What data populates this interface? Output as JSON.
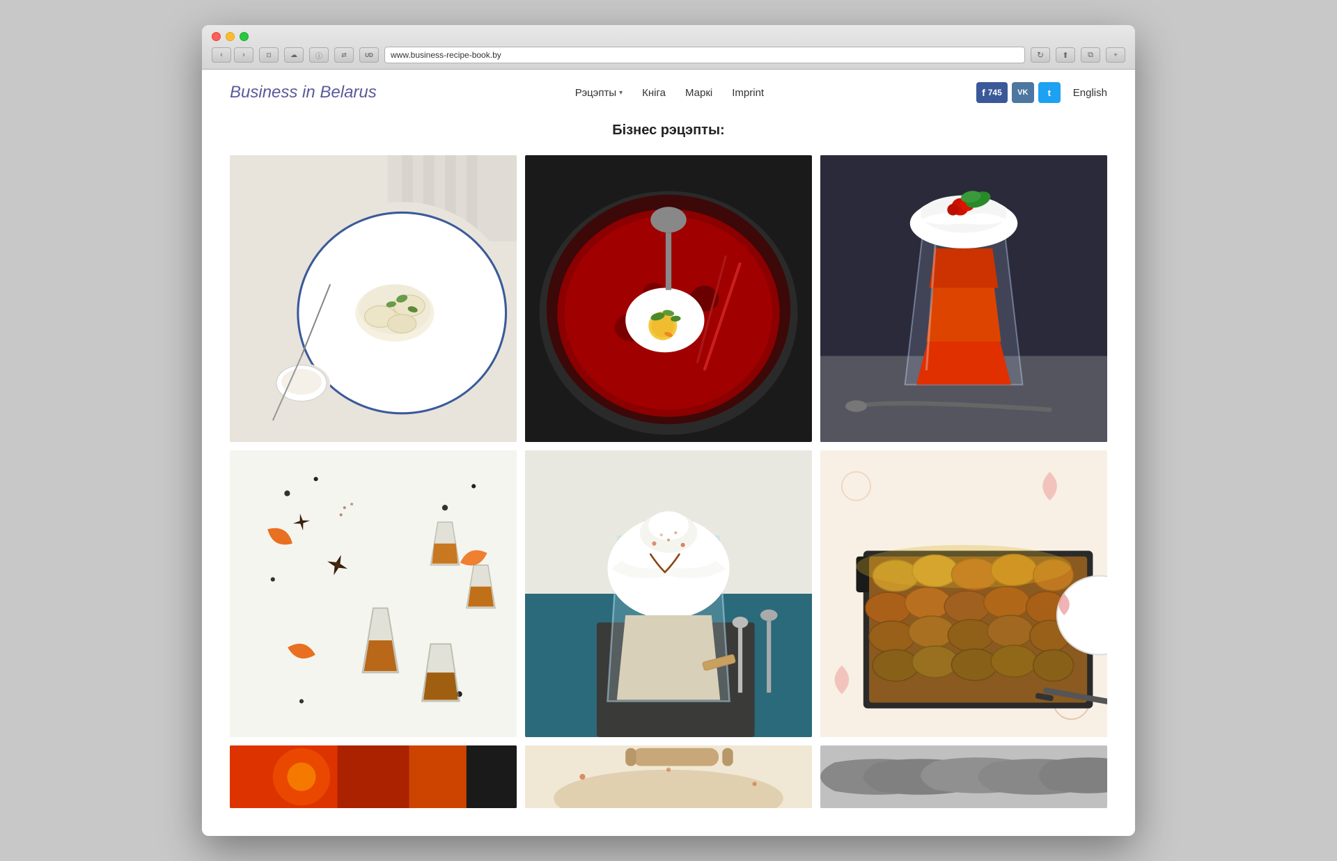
{
  "browser": {
    "url": "www.business-recipe-book.by",
    "back_label": "‹",
    "forward_label": "›",
    "reader_label": "⊡",
    "share_label": "⬆",
    "tab_plus": "+"
  },
  "header": {
    "logo": "Business in Belarus",
    "nav": {
      "recipes_label": "Рэцэпты",
      "book_label": "Кніга",
      "stamps_label": "Маркі",
      "imprint_label": "Imprint"
    },
    "social": {
      "facebook_label": "f",
      "facebook_count": "745",
      "vk_label": "VK",
      "twitter_label": "t",
      "language_label": "English"
    }
  },
  "main": {
    "page_title": "Бізнес рэцэпты:",
    "recipes": [
      {
        "id": 1,
        "title": "Dumplings dish",
        "color_scheme": "food-1"
      },
      {
        "id": 2,
        "title": "Borscht with egg",
        "color_scheme": "food-2"
      },
      {
        "id": 3,
        "title": "Red berry drink",
        "color_scheme": "food-3"
      },
      {
        "id": 4,
        "title": "Spice collection",
        "color_scheme": "food-4"
      },
      {
        "id": 5,
        "title": "Whipped cream dessert",
        "color_scheme": "food-5"
      },
      {
        "id": 6,
        "title": "Potato gratin",
        "color_scheme": "food-6"
      }
    ],
    "partial_recipes": [
      {
        "id": 7,
        "title": "Warm drink",
        "color_scheme": "food-7-partial"
      },
      {
        "id": 8,
        "title": "Pastry dish",
        "color_scheme": "food-8-partial"
      },
      {
        "id": 9,
        "title": "Fish dish",
        "color_scheme": "food-9-partial"
      }
    ]
  }
}
